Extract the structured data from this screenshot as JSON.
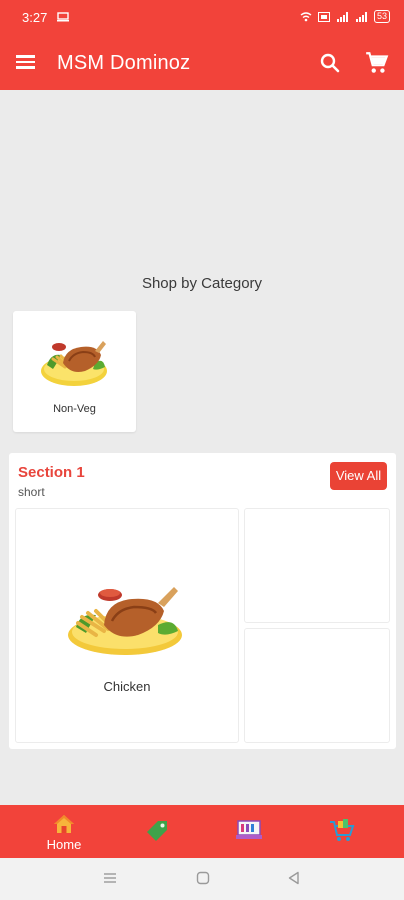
{
  "status_bar": {
    "time": "3:27",
    "battery": "53",
    "icons": [
      "screen-record-icon",
      "wifi-icon",
      "volte-icon",
      "signal-icon",
      "signal-icon",
      "battery-icon"
    ]
  },
  "app_bar": {
    "title": "MSM Dominoz",
    "menu_icon": "hamburger-menu-icon",
    "search_icon": "search-icon",
    "cart_icon": "shopping-cart-icon",
    "background": "#f2433a"
  },
  "shop_by_category": {
    "heading": "Shop by Category",
    "categories": [
      {
        "label": "Non-Veg",
        "image": "fried-chicken-plate"
      }
    ]
  },
  "section": {
    "title": "Section 1",
    "subtitle": "short",
    "view_all_label": "View All",
    "accent": "#e8453c",
    "products": [
      {
        "label": "Chicken",
        "image": "fried-chicken-plate"
      }
    ]
  },
  "bottom_nav": {
    "items": [
      {
        "label": "Home",
        "icon": "home-icon"
      },
      {
        "label": "",
        "icon": "offers-tag-icon"
      },
      {
        "label": "",
        "icon": "orders-icon"
      },
      {
        "label": "",
        "icon": "cart-icon"
      }
    ]
  },
  "system_nav": {
    "icons": [
      "recents-icon",
      "home-square-icon",
      "back-triangle-icon"
    ]
  }
}
